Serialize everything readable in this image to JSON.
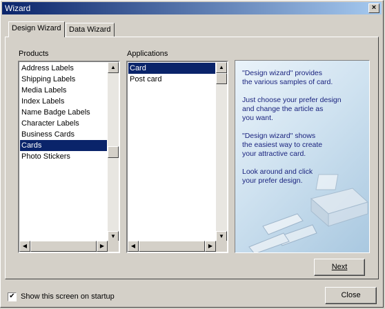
{
  "window": {
    "title": "Wizard"
  },
  "tabs": [
    {
      "label": "Design Wizard"
    },
    {
      "label": "Data Wizard"
    }
  ],
  "products": {
    "label": "Products",
    "items": [
      "Address Labels",
      "Shipping Labels",
      "Media Labels",
      "Index Labels",
      "Name Badge Labels",
      "Character Labels",
      "Business Cards",
      "Cards",
      "Photo Stickers"
    ],
    "selected": "Cards"
  },
  "applications": {
    "label": "Applications",
    "items": [
      "Card",
      "Post card"
    ],
    "selected": "Card"
  },
  "info": {
    "paragraphs": [
      "\"Design wizard\" provides\nthe various samples of card.",
      "Just choose your prefer design\nand change the article as\nyou want.",
      "\"Design wizard\" shows\nthe easiest way to create\nyour attractive card.",
      "Look around and click\nyour prefer design."
    ]
  },
  "buttons": {
    "next": "Next",
    "close": "Close"
  },
  "startup": {
    "label": "Show this screen on startup",
    "checked": true
  }
}
